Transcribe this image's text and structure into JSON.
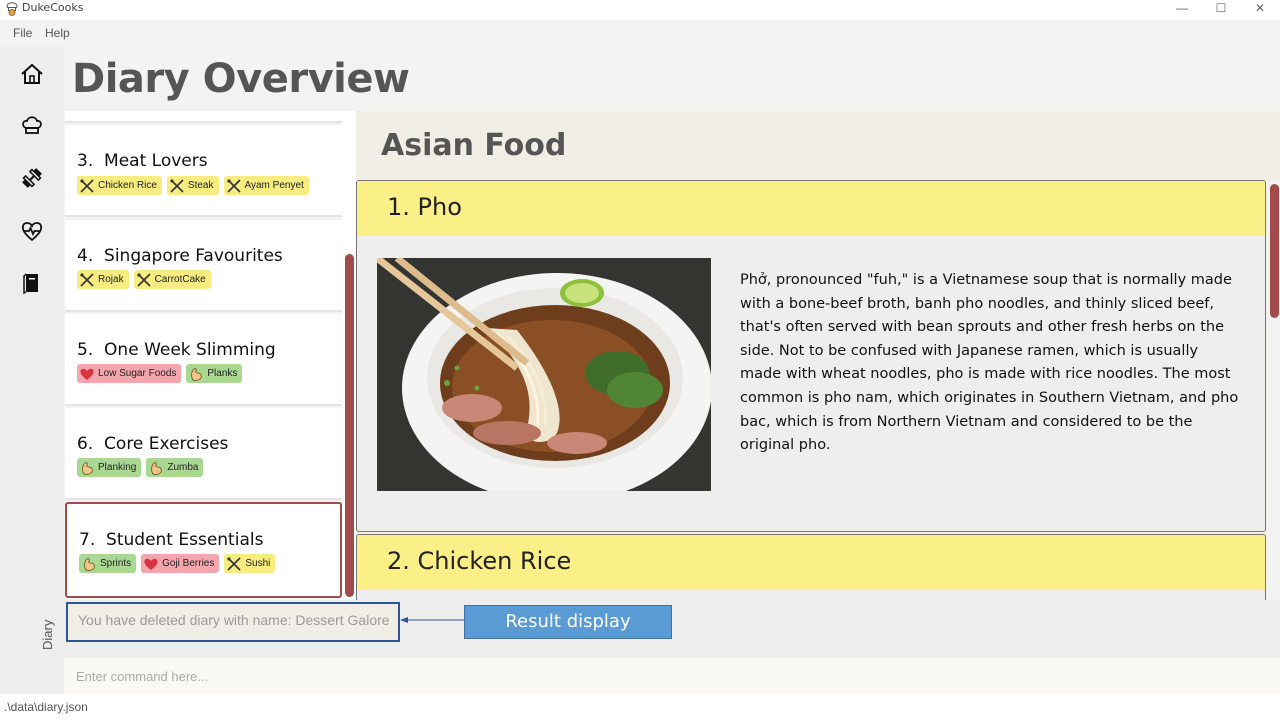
{
  "window": {
    "title": "DukeCooks",
    "minimize": "—",
    "maximize": "☐",
    "close": "✕"
  },
  "menu": {
    "file": "File",
    "help": "Help"
  },
  "nav": {
    "vertical_label": "Diary"
  },
  "header": {
    "title": "Diary Overview"
  },
  "diaries": [
    {
      "number": "3.",
      "name": "Meat Lovers",
      "tags": [
        {
          "type": "food",
          "icon": "food-icon",
          "label": "Chicken Rice"
        },
        {
          "type": "food",
          "icon": "food-icon",
          "label": "Steak"
        },
        {
          "type": "food",
          "icon": "food-icon",
          "label": "Ayam Penyet"
        }
      ]
    },
    {
      "number": "4.",
      "name": "Singapore Favourites",
      "tags": [
        {
          "type": "food",
          "icon": "food-icon",
          "label": "Rojak"
        },
        {
          "type": "food",
          "icon": "food-icon",
          "label": "CarrotCake"
        }
      ]
    },
    {
      "number": "5.",
      "name": "One Week Slimming",
      "tags": [
        {
          "type": "health",
          "icon": "heart-icon",
          "label": "Low Sugar Foods"
        },
        {
          "type": "exercise",
          "icon": "muscle-icon",
          "label": "Planks"
        }
      ]
    },
    {
      "number": "6.",
      "name": "Core Exercises",
      "tags": [
        {
          "type": "exercise",
          "icon": "muscle-icon",
          "label": "Planking"
        },
        {
          "type": "exercise",
          "icon": "muscle-icon",
          "label": "Zumba"
        }
      ]
    },
    {
      "number": "7.",
      "name": "Student Essentials",
      "selected": true,
      "tags": [
        {
          "type": "exercise",
          "icon": "muscle-icon",
          "label": "Sprints"
        },
        {
          "type": "health",
          "icon": "heart-icon",
          "label": "Goji Berries"
        },
        {
          "type": "food",
          "icon": "food-icon",
          "label": "Sushi"
        }
      ]
    }
  ],
  "content": {
    "section_title": "Asian Food",
    "pages": [
      {
        "title": "1. Pho",
        "description": "Phở, pronounced \"fuh,\" is a Vietnamese soup that is normally made with a bone-beef broth, banh pho noodles, and thinly sliced beef, that's often served with bean sprouts and other fresh herbs on the side. Not to be confused with Japanese ramen, which is usually made with wheat noodles, pho is made with rice noodles. The most common is pho nam, which originates in Southern Vietnam, and pho bac, which is from Northern Vietnam and considered to be the original pho."
      },
      {
        "title": "2. Chicken Rice",
        "description": ""
      }
    ]
  },
  "result": {
    "text": "You have deleted diary with name: Dessert Galore"
  },
  "annotation": {
    "label": "Result display"
  },
  "command": {
    "placeholder": "Enter command here..."
  },
  "status": {
    "path": ".\\data\\diary.json"
  },
  "colors": {
    "accent": "#a24b4b",
    "food_tag": "#f7ec80",
    "exercise_tag": "#a9d891",
    "health_tag": "#f4a5ae",
    "card_header": "#fbf088",
    "annotation": "#5b9bd5"
  }
}
